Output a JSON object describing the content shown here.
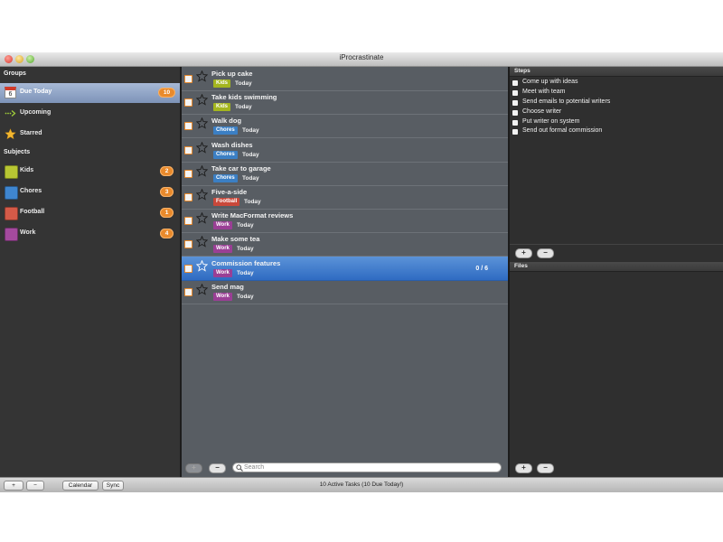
{
  "window": {
    "title": "iProcrastinate"
  },
  "sidebar": {
    "groups_title": "Groups",
    "groups": [
      {
        "label": "Due Today",
        "badge": "10",
        "icon": "calendar-icon",
        "icon_text": "6",
        "selected": true
      },
      {
        "label": "Upcoming",
        "badge": "",
        "icon": "arrow-right-dotted-icon"
      },
      {
        "label": "Starred",
        "badge": "",
        "icon": "star-icon"
      }
    ],
    "subjects_title": "Subjects",
    "subjects": [
      {
        "label": "Kids",
        "badge": "2",
        "color": "#b8c633"
      },
      {
        "label": "Chores",
        "badge": "3",
        "color": "#3f86cf"
      },
      {
        "label": "Football",
        "badge": "1",
        "color": "#d45a48"
      },
      {
        "label": "Work",
        "badge": "4",
        "color": "#a44a9e"
      }
    ]
  },
  "tasks": [
    {
      "name": "Pick up cake",
      "tag": "Kids",
      "tag_color": "#a4b61f",
      "due": "Today",
      "progress": ""
    },
    {
      "name": "Take kids swimming",
      "tag": "Kids",
      "tag_color": "#a4b61f",
      "due": "Today",
      "progress": ""
    },
    {
      "name": "Walk dog",
      "tag": "Chores",
      "tag_color": "#3b7fc4",
      "due": "Today",
      "progress": ""
    },
    {
      "name": "Wash dishes",
      "tag": "Chores",
      "tag_color": "#3b7fc4",
      "due": "Today",
      "progress": ""
    },
    {
      "name": "Take car to garage",
      "tag": "Chores",
      "tag_color": "#3b7fc4",
      "due": "Today",
      "progress": ""
    },
    {
      "name": "Five-a-side",
      "tag": "Football",
      "tag_color": "#c9483a",
      "due": "Today",
      "progress": ""
    },
    {
      "name": "Write MacFormat reviews",
      "tag": "Work",
      "tag_color": "#9a3f95",
      "due": "Today",
      "progress": ""
    },
    {
      "name": "Make some tea",
      "tag": "Work",
      "tag_color": "#9a3f95",
      "due": "Today",
      "progress": ""
    },
    {
      "name": "Commission features",
      "tag": "Work",
      "tag_color": "#9a3f95",
      "due": "Today",
      "progress": "0 / 6",
      "selected": true
    },
    {
      "name": "Send mag",
      "tag": "Work",
      "tag_color": "#9a3f95",
      "due": "Today",
      "progress": ""
    }
  ],
  "task_footer": {
    "add": "+",
    "remove": "−",
    "search_placeholder": "Search"
  },
  "steps": {
    "title": "Steps",
    "items": [
      "Come up with ideas",
      "Meet with team",
      "Send emails to potential writers",
      "Choose writer",
      "Put writer on system",
      "Send out formal commission"
    ],
    "add": "+",
    "remove": "−"
  },
  "files": {
    "title": "Files",
    "add": "+",
    "remove": "−"
  },
  "bottom": {
    "add": "+",
    "remove": "−",
    "calendar": "Calendar",
    "sync": "Sync",
    "status": "10 Active Tasks (10 Due Today!)"
  },
  "colors": {
    "accent": "#e98a2c",
    "selection": "#3a78c8"
  }
}
